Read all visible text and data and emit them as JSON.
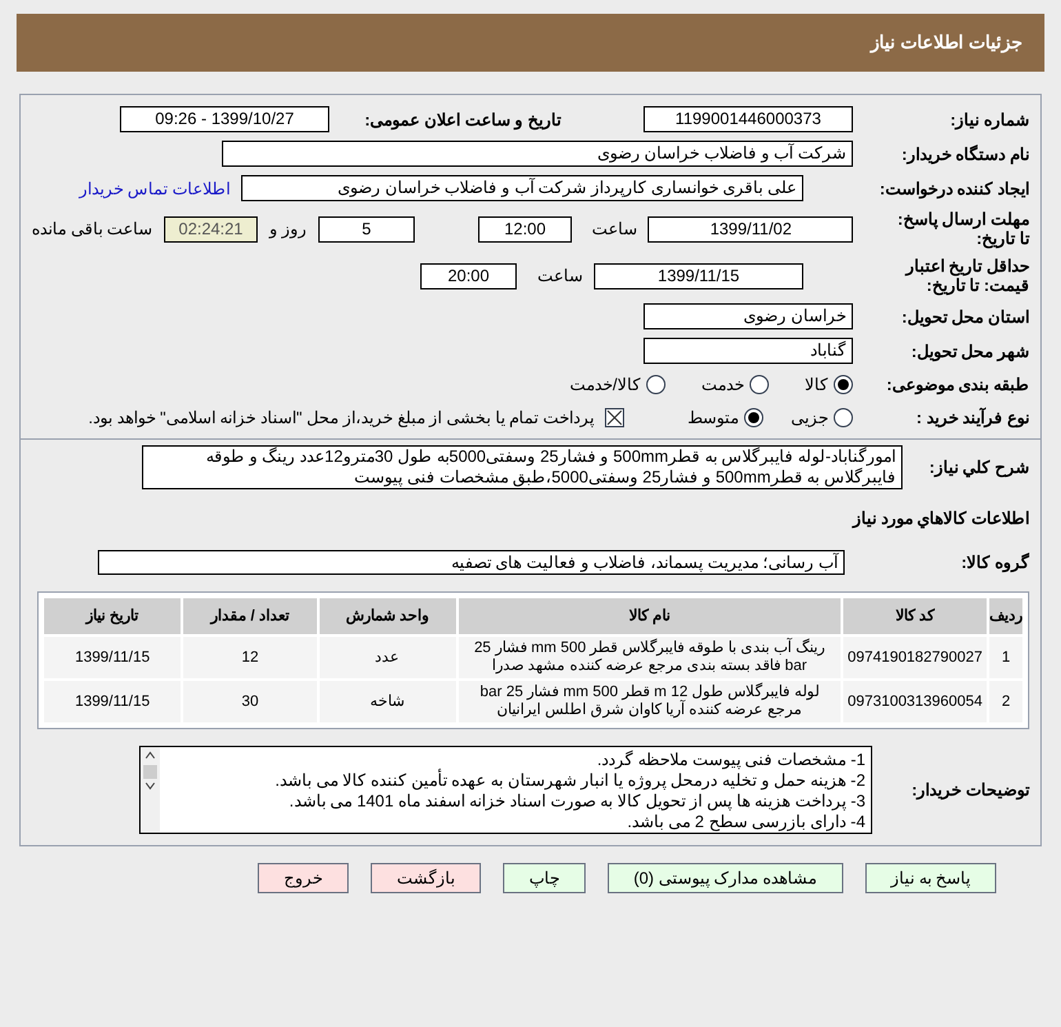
{
  "header": {
    "title": "جزئیات اطلاعات نیاز"
  },
  "need_number": {
    "label": "شماره نیاز:",
    "value": "1199001446000373"
  },
  "announce": {
    "label": "تاریخ و ساعت اعلان عمومی:",
    "value": "1399/10/27 - 09:26"
  },
  "buyer": {
    "label": "نام دستگاه خریدار:",
    "value": "شرکت آب و فاضلاب خراسان رضوی"
  },
  "creator": {
    "label": "ایجاد کننده درخواست:",
    "value": "علی باقری خوانساری کارپرداز شرکت آب و فاضلاب خراسان رضوی",
    "link": "اطلاعات تماس خریدار"
  },
  "deadline": {
    "label": "مهلت ارسال پاسخ: تا تاریخ:",
    "date": "1399/11/02",
    "time_label": "ساعت",
    "time": "12:00",
    "days": "5",
    "days_label": "روز و",
    "remaining": "02:24:21",
    "remaining_label": "ساعت باقی مانده"
  },
  "validity": {
    "label": "حداقل تاریخ اعتبار قیمت: تا تاریخ:",
    "date": "1399/11/15",
    "time_label": "ساعت",
    "time": "20:00"
  },
  "province": {
    "label": "استان محل تحویل:",
    "value": "خراسان رضوی"
  },
  "city": {
    "label": "شهر محل تحویل:",
    "value": "گناباد"
  },
  "category": {
    "label": "طبقه بندی موضوعی:",
    "options": [
      {
        "label": "کالا",
        "selected": true
      },
      {
        "label": "خدمت",
        "selected": false
      },
      {
        "label": "کالا/خدمت",
        "selected": false
      }
    ]
  },
  "process": {
    "label": "نوع فرآیند خرید :",
    "options": [
      {
        "label": "جزیی",
        "selected": false
      },
      {
        "label": "متوسط",
        "selected": true
      }
    ],
    "payment": {
      "checked": true,
      "label": "پرداخت تمام یا بخشی از مبلغ خرید،از محل \"اسناد خزانه اسلامی\" خواهد بود."
    }
  },
  "description": {
    "label": "شرح كلي نياز:",
    "value": "امورگناباد-لوله فایبرگلاس به قطر500mm و فشار25 وسفتی5000به طول 30مترو12عدد رینگ و طوقه فایبرگلاس به قطر500mm و فشار25 وسفتی5000،طبق مشخصات فنی پیوست"
  },
  "goods_title": "اطلاعات كالاهاي مورد نياز",
  "group": {
    "label": "گروه كالا:",
    "value": "آب رسانی؛ مدیریت پسماند، فاضلاب و فعالیت های تصفیه"
  },
  "table": {
    "columns": [
      "ردیف",
      "کد کالا",
      "نام کالا",
      "واحد شمارش",
      "تعداد / مقدار",
      "تاریخ نیاز"
    ],
    "rows": [
      [
        "1",
        "0974190182790027",
        "رینگ آب بندی با طوقه فایبرگلاس قطر 500 mm فشار 25 bar فاقد بسته بندی مرجع عرضه کننده مشهد صدرا",
        "عدد",
        "12",
        "1399/11/15"
      ],
      [
        "2",
        "0973100313960054",
        "لوله فایبرگلاس طول 12 m قطر 500 mm فشار 25 bar مرجع عرضه کننده آریا کاوان شرق اطلس ایرانیان",
        "شاخه",
        "30",
        "1399/11/15"
      ]
    ]
  },
  "notes": {
    "label": "توضیحات خریدار:",
    "lines": [
      "1- مشخصات فنی پیوست ملاحظه گردد.",
      "2- هزینه حمل و تخلیه درمحل پروژه یا انبار شهرستان به عهده تأمین کننده کالا می باشد.",
      "3- پرداخت هزینه ها پس از تحویل کالا به صورت اسناد خزانه اسفند ماه 1401 می باشد.",
      "4- دارای بازرسی سطح 2 می باشد."
    ]
  },
  "buttons": [
    {
      "label": "پاسخ به نیاز",
      "kind": "green"
    },
    {
      "label": "مشاهده مدارک پیوستی (0)",
      "kind": "green"
    },
    {
      "label": "چاپ",
      "kind": "green"
    },
    {
      "label": "بازگشت",
      "kind": "red"
    },
    {
      "label": "خروج",
      "kind": "red"
    }
  ]
}
